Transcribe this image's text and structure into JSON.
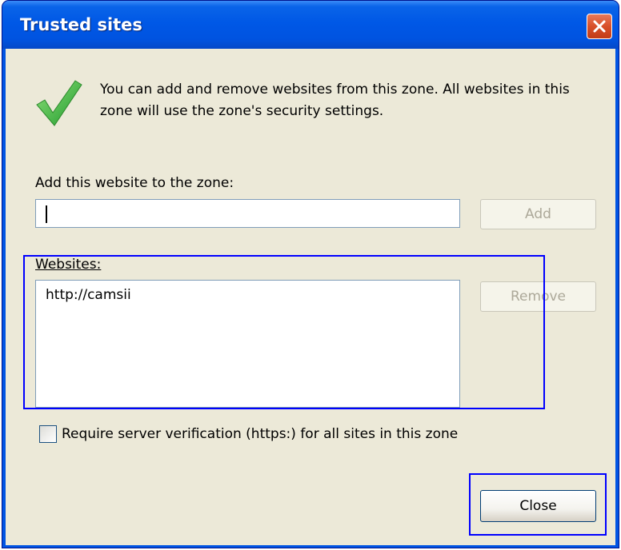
{
  "window": {
    "title": "Trusted sites"
  },
  "info": {
    "icon": "checkmark-icon",
    "message": "You can add and remove websites from this zone. All websites in this zone will use the zone's security settings."
  },
  "add_section": {
    "label": "Add this website to the zone:",
    "input_value": "",
    "add_button": "Add"
  },
  "websites_section": {
    "label": "Websites:",
    "items": [
      "http://camsii"
    ],
    "remove_button": "Remove"
  },
  "options": {
    "require_https_label": "Require server verification (https:) for all sites in this zone",
    "require_https_checked": false
  },
  "footer": {
    "close_button": "Close"
  },
  "colors": {
    "titlebar": "#0054e3",
    "client_bg": "#ece9d8",
    "highlight": "#0000ff"
  }
}
